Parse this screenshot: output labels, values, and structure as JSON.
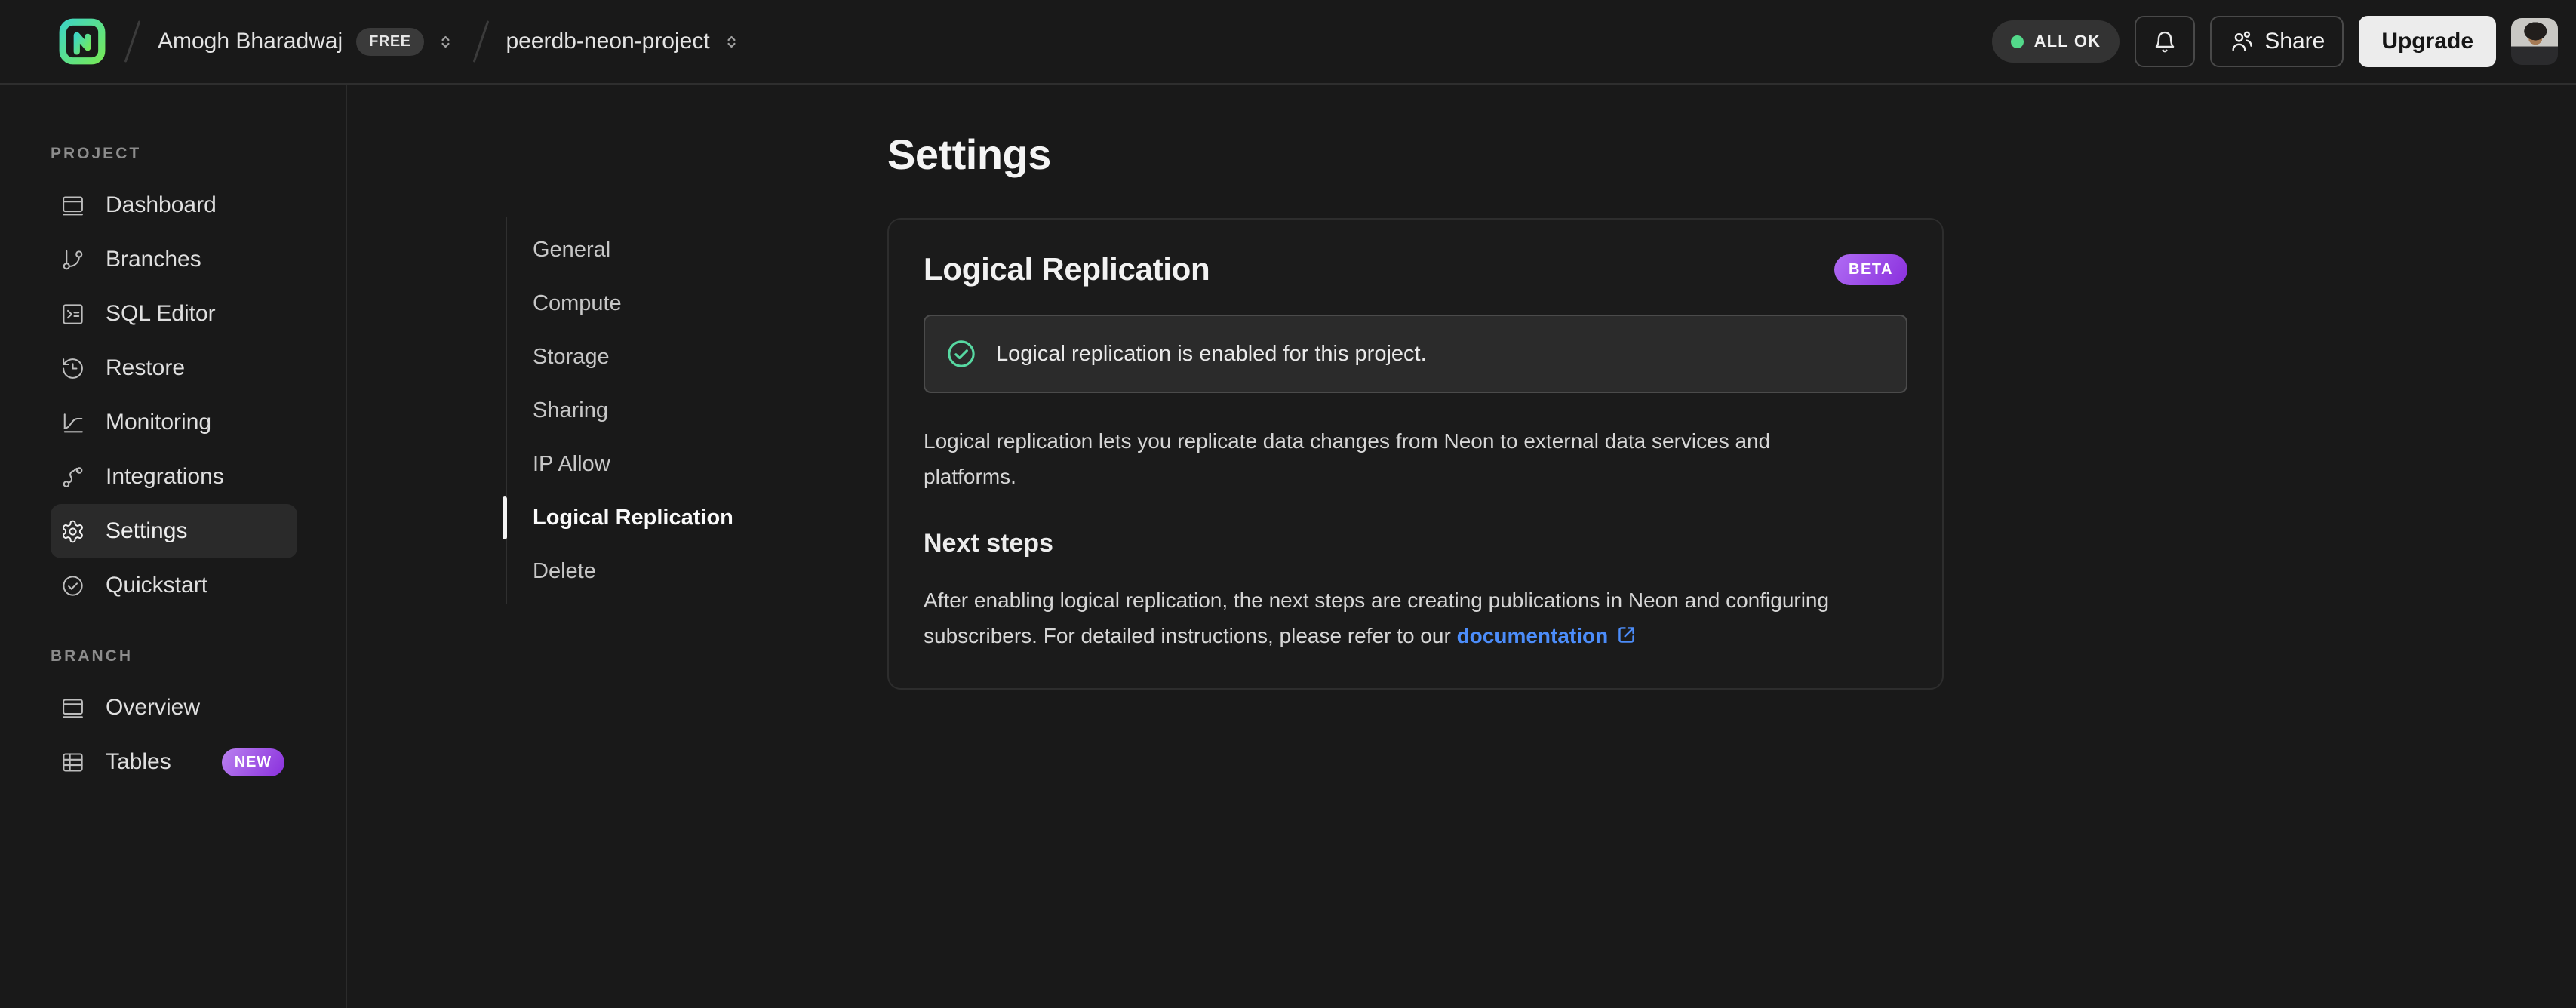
{
  "header": {
    "breadcrumb": {
      "account": "Amogh Bharadwaj",
      "account_badge": "FREE",
      "project": "peerdb-neon-project"
    },
    "status": "ALL OK",
    "share_label": "Share",
    "upgrade_label": "Upgrade",
    "icons": [
      "neon-logo",
      "chevron-up-down",
      "status-dot",
      "bell",
      "users",
      "avatar"
    ]
  },
  "sidebar": {
    "sections": [
      {
        "label": "PROJECT",
        "items": [
          {
            "label": "Dashboard",
            "icon": "browser-window"
          },
          {
            "label": "Branches",
            "icon": "git-branch"
          },
          {
            "label": "SQL Editor",
            "icon": "terminal-square"
          },
          {
            "label": "Restore",
            "icon": "history-clock"
          },
          {
            "label": "Monitoring",
            "icon": "chart-curve"
          },
          {
            "label": "Integrations",
            "icon": "workflow-route"
          },
          {
            "label": "Settings",
            "icon": "gear",
            "active": true
          },
          {
            "label": "Quickstart",
            "icon": "check-circle"
          }
        ]
      },
      {
        "label": "BRANCH",
        "items": [
          {
            "label": "Overview",
            "icon": "browser-window"
          },
          {
            "label": "Tables",
            "icon": "table-grid",
            "badge": "NEW"
          }
        ]
      }
    ]
  },
  "settings_nav": {
    "items": [
      "General",
      "Compute",
      "Storage",
      "Sharing",
      "IP Allow",
      "Logical Replication",
      "Delete"
    ],
    "active": "Logical Replication"
  },
  "main": {
    "title": "Settings",
    "card": {
      "title": "Logical Replication",
      "badge": "BETA",
      "alert": "Logical replication is enabled for this project.",
      "alert_icon": "check-circle",
      "description": [
        "Logical replication lets you replicate data changes from Neon to external data services and",
        "platforms."
      ],
      "next_steps_title": "Next steps",
      "next_steps": [
        "After enabling logical replication, the next steps are creating publications in Neon and configuring",
        "subscribers. For detailed instructions, please refer to our "
      ],
      "doc_link": "documentation",
      "doc_link_icon": "external-link"
    }
  },
  "colors": {
    "background": "#191919",
    "border": "#2e2e2e",
    "accent_green": "#57d9a2",
    "status_dot_green": "#53d98a",
    "badge_purple_from": "#b06cf4",
    "badge_purple_to": "#8a30dd",
    "link_blue": "#4c8dfa",
    "upgrade_bg": "#ececec"
  }
}
